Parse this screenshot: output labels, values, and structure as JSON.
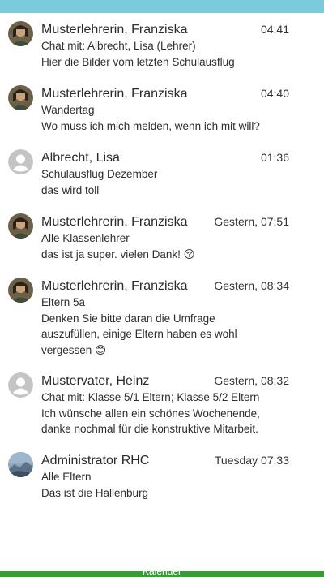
{
  "messages": [
    {
      "sender": "Musterlehrerin, Franziska",
      "time": "04:41",
      "line1": "Chat mit: Albrecht, Lisa (Lehrer)",
      "line2": "Hier die Bilder vom letzten Schulausflug",
      "line3": "",
      "avatar": "photo"
    },
    {
      "sender": "Musterlehrerin, Franziska",
      "time": "04:40",
      "line1": "Wandertag",
      "line2": "Wo muss ich mich melden, wenn ich mit will?",
      "line3": "",
      "avatar": "photo"
    },
    {
      "sender": "Albrecht, Lisa",
      "time": "01:36",
      "line1": "Schulausflug Dezember",
      "line2": "das wird toll",
      "line3": "",
      "avatar": "placeholder"
    },
    {
      "sender": "Musterlehrerin, Franziska",
      "time": "Gestern, 07:51",
      "line1": "Alle Klassenlehrer",
      "line2": "das ist ja super. vielen Dank! 😚",
      "line3": "",
      "avatar": "photo"
    },
    {
      "sender": "Musterlehrerin, Franziska",
      "time": "Gestern, 08:34",
      "line1": "Eltern 5a",
      "line2": "Denken Sie bitte daran die Umfrage",
      "line3": "auszufüllen, einige Eltern haben es wohl",
      "line4": "vergessen 😊",
      "avatar": "photo"
    },
    {
      "sender": "Mustervater, Heinz",
      "time": "Gestern, 08:32",
      "line1": "Chat mit: Klasse 5/1 Eltern; Klasse 5/2 Eltern",
      "line2": "Ich wünsche allen ein schönes Wochenende,",
      "line3": "danke nochmal für die konstruktive Mitarbeit.",
      "avatar": "placeholder"
    },
    {
      "sender": "Administrator RHC",
      "time": "Tuesday 07:33",
      "line1": "Alle Eltern",
      "line2": "Das ist die Hallenburg",
      "line3": "",
      "avatar": "landscape"
    }
  ],
  "bottom_bar_label": "Kalender",
  "colors": {
    "top_bar": "#7ccbdd",
    "bottom_bar": "#3a9a3a",
    "placeholder_avatar": "#c4c4c4"
  }
}
